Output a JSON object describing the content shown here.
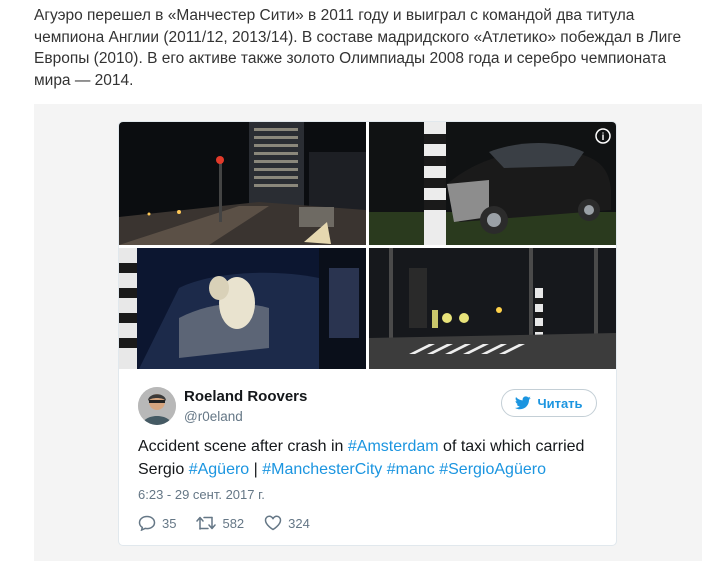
{
  "article": {
    "paragraph": "Агуэро перешел в «Манчестер Сити» в 2011 году и выиграл с командой два титула чемпиона Англии (2011/12, 2013/14). В составе мадридского «Атлетико» побеждал в Лиге Европы (2010). В его активе также золото Олимпиады 2008 года и серебро чемпионата мира — 2014."
  },
  "tweet": {
    "display_name": "Roeland Roovers",
    "handle": "@r0eland",
    "follow_label": "Читать",
    "text": {
      "p1": "Accident scene after crash in ",
      "h1": "#Amsterdam",
      "p2": " of taxi which carried Sergio ",
      "h2": "#Agüero",
      "p3": " | ",
      "h3": "#ManchesterCity",
      "p4": " ",
      "h4": "#manc",
      "p5": " ",
      "h5": "#SergioAgüero"
    },
    "timestamp": "6:23 - 29 сент. 2017 г.",
    "replies": "35",
    "retweets": "582",
    "likes": "324",
    "info_symbol": "i"
  },
  "icons": {
    "follow": "twitter-bird-icon",
    "reply": "reply-icon",
    "retweet": "retweet-icon",
    "like": "heart-icon",
    "info": "info-icon"
  },
  "colors": {
    "link": "#1b95e0",
    "text": "#14171a",
    "muted": "#657786",
    "embed_background": "#f4f4f4",
    "border": "#e1e8ed"
  }
}
